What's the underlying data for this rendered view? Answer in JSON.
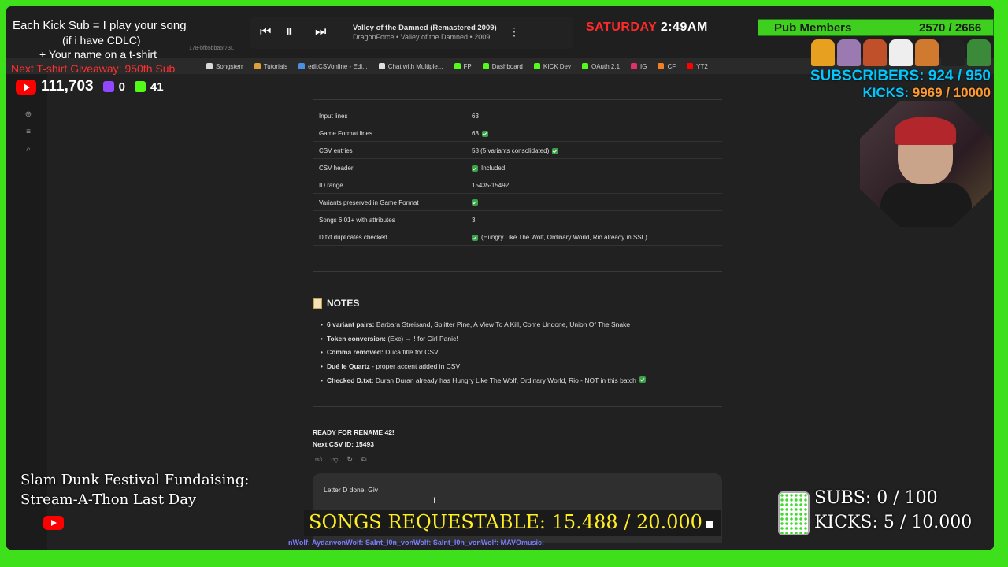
{
  "browser": {
    "url_fragment": "178-bfb5bba5f73L",
    "bookmarks": [
      {
        "label": "Songsterr",
        "color": "#d9d9d9"
      },
      {
        "label": "Tutorials",
        "color": "#d9a13a"
      },
      {
        "label": "editCSVonline - Edi...",
        "color": "#4a90e2"
      },
      {
        "label": "Chat with Multiple...",
        "color": "#e0e0e0"
      },
      {
        "label": "FP",
        "color": "#53fc18"
      },
      {
        "label": "Dashboard",
        "color": "#53fc18"
      },
      {
        "label": "KICK Dev",
        "color": "#53fc18"
      },
      {
        "label": "OAuth 2.1",
        "color": "#53fc18"
      },
      {
        "label": "IG",
        "color": "#e1306c"
      },
      {
        "label": "CF",
        "color": "#f38020"
      },
      {
        "label": "YT2",
        "color": "#ff0000"
      }
    ]
  },
  "table": {
    "rows": [
      {
        "key": "Input lines",
        "value": "63",
        "check": false
      },
      {
        "key": "Game Format lines",
        "value": "63",
        "check": true
      },
      {
        "key": "CSV entries",
        "value": "58 (5 variants consolidated)",
        "check": true
      },
      {
        "key": "CSV header",
        "value": "Included",
        "check": true,
        "check_first": true
      },
      {
        "key": "ID range",
        "value": "15435-15492",
        "check": false
      },
      {
        "key": "Variants preserved in Game Format",
        "value": "",
        "check": true,
        "check_first": true
      },
      {
        "key": "Songs 6:01+ with attributes",
        "value": "3",
        "check": false
      },
      {
        "key": "D.txt duplicates checked",
        "value": "(Hungry Like The Wolf, Ordinary World, Rio already in SSL)",
        "check": true,
        "check_first": true
      }
    ]
  },
  "notes": {
    "heading": "NOTES",
    "items": [
      {
        "bold": "6 variant pairs:",
        "text": " Barbara Streisand, Splitter Pine, A View To A Kill, Come Undone, Union Of The Snake"
      },
      {
        "bold": "Token conversion:",
        "text": " (Exc) → ! for Girl Panic!"
      },
      {
        "bold": "Comma removed:",
        "text": " Duca title for CSV"
      },
      {
        "bold": "Dué le Quartz",
        "text": " - proper accent added in CSV"
      },
      {
        "bold": "Checked D.txt:",
        "text": " Duran Duran already has Hungry Like The Wolf, Ordinary World, Rio - NOT in this batch"
      }
    ]
  },
  "response": {
    "ready": "READY FOR RENAME 42!",
    "next_id": "Next CSV ID: 15493"
  },
  "input": {
    "value": "Letter D done. Giv"
  },
  "overlay": {
    "sub_line1": "Each Kick Sub = I play your song",
    "sub_line2": "(if i have CDLC)",
    "sub_line3": "+ Your name on a t-shirt",
    "sub_line4": "Next T-shirt Giveaway: 950th Sub",
    "yt_count": "111,703",
    "twitch_count": "0",
    "kick_count": "41",
    "player": {
      "title": "Valley of the Damned (Remastered 2009)",
      "subtitle": "DragonForce • Valley of the Damned • 2009"
    },
    "clock": {
      "day": "SATURDAY",
      "time": "2:49AM"
    },
    "pub_members": {
      "label": "Pub Members",
      "value": "2570 / 2666"
    },
    "subscribers": "SUBSCRIBERS: 924 / 950",
    "kicks_label": "KICKS:",
    "kicks_value": "9969 / 10000",
    "fund_line1": "Slam Dunk Festival Fundaising:",
    "fund_line2": "Stream-A-Thon Last Day",
    "songs_requestable": "SONGS REQUESTABLE: 15.488 / 20.000",
    "goal_subs": "SUBS:  0 / 100",
    "goal_kicks": "KICKS: 5 / 10.000",
    "ticker": "nWolf:  AydanvonWolf:  SaInt_l0n_vonWolf:  SaInt_l0n_vonWolf:  MAVOmusic:"
  },
  "colors": {
    "green_screen": "#3ee01c",
    "kick_green": "#53fc18",
    "youtube_red": "#ff0000",
    "songs_yellow": "#ffee22",
    "subs_cyan": "#00c8ff"
  }
}
